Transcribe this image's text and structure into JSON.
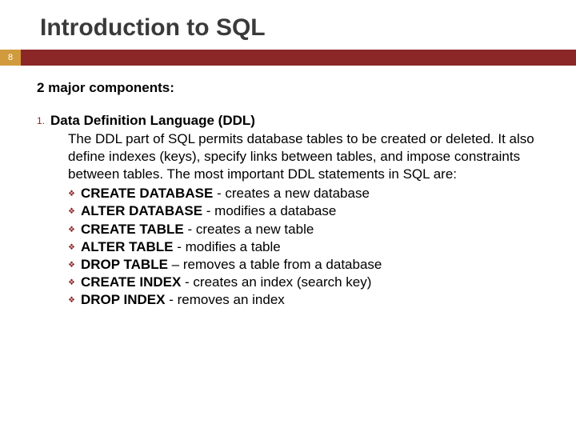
{
  "slide": {
    "title": "Introduction to SQL",
    "page_number": "8",
    "subhead": "2 major components:",
    "item_number": "1.",
    "item_heading": "Data Definition Language (DDL)",
    "item_desc": "The DDL part of SQL permits database tables to be created or deleted. It also define indexes (keys), specify links between tables, and impose constraints between tables. The most important DDL statements in SQL are:",
    "bullets": [
      {
        "bold": "CREATE DATABASE",
        "rest": " - creates a new database"
      },
      {
        "bold": "ALTER DATABASE",
        "rest": " - modifies a database"
      },
      {
        "bold": "CREATE TABLE",
        "rest": " - creates a new table"
      },
      {
        "bold": "ALTER TABLE",
        "rest": " - modifies a table"
      },
      {
        "bold": "DROP TABLE",
        "rest": " – removes a table from a database"
      },
      {
        "bold": "CREATE INDEX",
        "rest": " - creates an index (search key)"
      },
      {
        "bold": "DROP INDEX",
        "rest": " - removes an index"
      }
    ]
  }
}
